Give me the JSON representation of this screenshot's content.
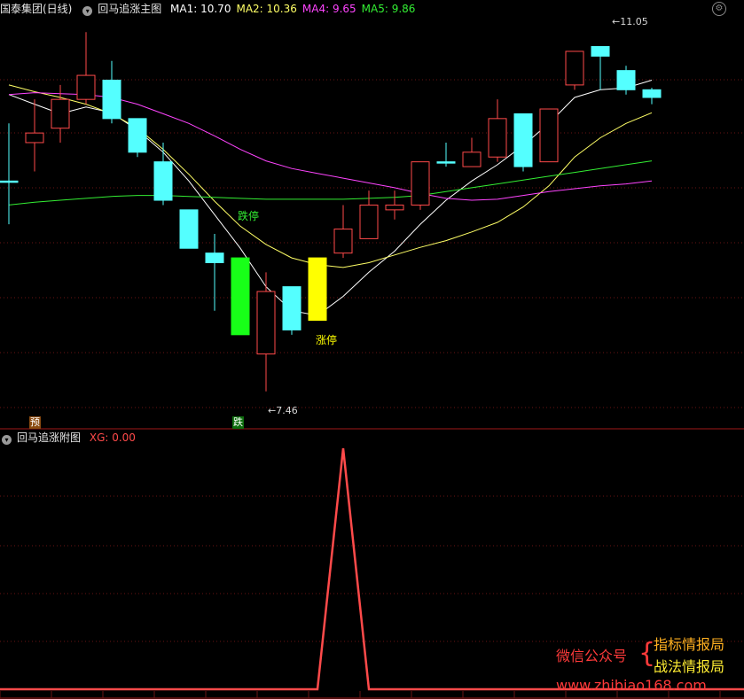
{
  "header": {
    "stock_name": "国泰集团(日线)",
    "main_indicator": "回马追涨主图",
    "ma": [
      {
        "label": "MA1: 10.70",
        "color": "#ffffff"
      },
      {
        "label": "MA2: 10.36",
        "color": "#ffff66"
      },
      {
        "label": "MA4: 9.65",
        "color": "#ff44ff"
      },
      {
        "label": "MA5: 9.86",
        "color": "#33ee33"
      }
    ]
  },
  "sub_header": {
    "indicator": "回马追涨附图",
    "xg_label": "XG: 0.00"
  },
  "annotations": {
    "high_label": "11.05",
    "low_label": "7.46",
    "limit_down": "跌停",
    "limit_up": "涨停",
    "marker_yu": "预",
    "marker_die": "跌"
  },
  "watermark": {
    "line1": "微信公众号",
    "right1": "指标情报局",
    "right2": "战法情报局",
    "url": "www.zhibiao168.com"
  },
  "colors": {
    "up": "#ff4a4a",
    "down": "#54ffff",
    "limit_down_fill": "#18ff18",
    "limit_up_fill": "#ffff00",
    "ma_white": "#ffffff",
    "ma_yellow": "#ffff66",
    "ma_magenta": "#ff44ff",
    "ma_green": "#33ee33",
    "xg_line": "#ff4a4a"
  },
  "chart_data": {
    "type": "candlestick",
    "ylim": [
      7.2,
      11.35
    ],
    "candles": [
      {
        "o": 9.65,
        "c": 9.65,
        "h": 10.25,
        "l": 9.2,
        "dir": "down"
      },
      {
        "o": 10.05,
        "c": 10.15,
        "h": 10.5,
        "l": 9.75,
        "dir": "up"
      },
      {
        "o": 10.2,
        "c": 10.5,
        "h": 10.65,
        "l": 10.05,
        "dir": "up"
      },
      {
        "o": 10.5,
        "c": 10.75,
        "h": 11.2,
        "l": 10.45,
        "dir": "up"
      },
      {
        "o": 10.7,
        "c": 10.3,
        "h": 10.9,
        "l": 10.25,
        "dir": "down"
      },
      {
        "o": 10.3,
        "c": 9.95,
        "h": 10.3,
        "l": 9.9,
        "dir": "down"
      },
      {
        "o": 9.85,
        "c": 9.45,
        "h": 10.05,
        "l": 9.4,
        "dir": "down"
      },
      {
        "o": 9.35,
        "c": 8.95,
        "h": 9.35,
        "l": 8.95,
        "dir": "down"
      },
      {
        "o": 8.9,
        "c": 8.8,
        "h": 9.1,
        "l": 8.3,
        "dir": "down"
      },
      {
        "o": 8.85,
        "c": 8.05,
        "h": 8.85,
        "l": 8.05,
        "dir": "down",
        "special": "limit_down"
      },
      {
        "o": 7.85,
        "c": 8.5,
        "h": 8.7,
        "l": 7.46,
        "dir": "up"
      },
      {
        "o": 8.55,
        "c": 8.1,
        "h": 8.55,
        "l": 8.05,
        "dir": "down"
      },
      {
        "o": 8.85,
        "c": 8.2,
        "h": 8.85,
        "l": 8.2,
        "dir": "down",
        "special": "limit_up"
      },
      {
        "o": 8.9,
        "c": 9.15,
        "h": 9.4,
        "l": 8.85,
        "dir": "up"
      },
      {
        "o": 9.05,
        "c": 9.4,
        "h": 9.55,
        "l": 9.05,
        "dir": "up"
      },
      {
        "o": 9.35,
        "c": 9.4,
        "h": 9.55,
        "l": 9.25,
        "dir": "up"
      },
      {
        "o": 9.4,
        "c": 9.85,
        "h": 9.85,
        "l": 9.35,
        "dir": "up"
      },
      {
        "o": 9.85,
        "c": 9.85,
        "h": 10.05,
        "l": 9.8,
        "dir": "down"
      },
      {
        "o": 9.8,
        "c": 9.95,
        "h": 10.1,
        "l": 9.8,
        "dir": "up"
      },
      {
        "o": 9.9,
        "c": 10.3,
        "h": 10.5,
        "l": 9.85,
        "dir": "up"
      },
      {
        "o": 10.35,
        "c": 9.8,
        "h": 10.35,
        "l": 9.75,
        "dir": "down"
      },
      {
        "o": 9.85,
        "c": 10.4,
        "h": 10.4,
        "l": 9.85,
        "dir": "up"
      },
      {
        "o": 10.65,
        "c": 11.0,
        "h": 11.0,
        "l": 10.6,
        "dir": "up"
      },
      {
        "o": 11.05,
        "c": 10.95,
        "h": 11.05,
        "l": 10.6,
        "dir": "down"
      },
      {
        "o": 10.8,
        "c": 10.6,
        "h": 10.85,
        "l": 10.55,
        "dir": "down"
      },
      {
        "o": 10.6,
        "c": 10.52,
        "h": 10.62,
        "l": 10.45,
        "dir": "down"
      }
    ],
    "ma_lines": [
      {
        "name": "MA1",
        "values": [
          10.55,
          10.45,
          10.35,
          10.42,
          10.36,
          10.18,
          9.95,
          9.65,
          9.3,
          8.95,
          8.55,
          8.3,
          8.25,
          8.45,
          8.7,
          8.92,
          9.2,
          9.45,
          9.65,
          9.82,
          10.02,
          10.25,
          10.52,
          10.6,
          10.62,
          10.7
        ]
      },
      {
        "name": "MA2",
        "values": [
          10.65,
          10.58,
          10.52,
          10.45,
          10.35,
          10.2,
          9.98,
          9.72,
          9.44,
          9.18,
          8.99,
          8.85,
          8.78,
          8.75,
          8.8,
          8.88,
          8.96,
          9.03,
          9.12,
          9.22,
          9.38,
          9.6,
          9.9,
          10.1,
          10.25,
          10.36
        ]
      },
      {
        "name": "MA4",
        "values": [
          10.55,
          10.57,
          10.56,
          10.55,
          10.52,
          10.45,
          10.35,
          10.25,
          10.12,
          9.98,
          9.86,
          9.78,
          9.73,
          9.68,
          9.63,
          9.58,
          9.52,
          9.47,
          9.45,
          9.46,
          9.5,
          9.54,
          9.57,
          9.6,
          9.62,
          9.65
        ]
      },
      {
        "name": "MA5",
        "values": [
          9.4,
          9.43,
          9.45,
          9.47,
          9.49,
          9.5,
          9.5,
          9.49,
          9.48,
          9.47,
          9.46,
          9.46,
          9.46,
          9.46,
          9.47,
          9.48,
          9.5,
          9.54,
          9.58,
          9.62,
          9.66,
          9.7,
          9.74,
          9.78,
          9.82,
          9.86
        ]
      }
    ],
    "xg": {
      "values": [
        0,
        0,
        0,
        0,
        0,
        0,
        0,
        0,
        0,
        0,
        0,
        0,
        0,
        1,
        0,
        0,
        0,
        0,
        0,
        0,
        0,
        0,
        0,
        0,
        0,
        0
      ]
    }
  }
}
